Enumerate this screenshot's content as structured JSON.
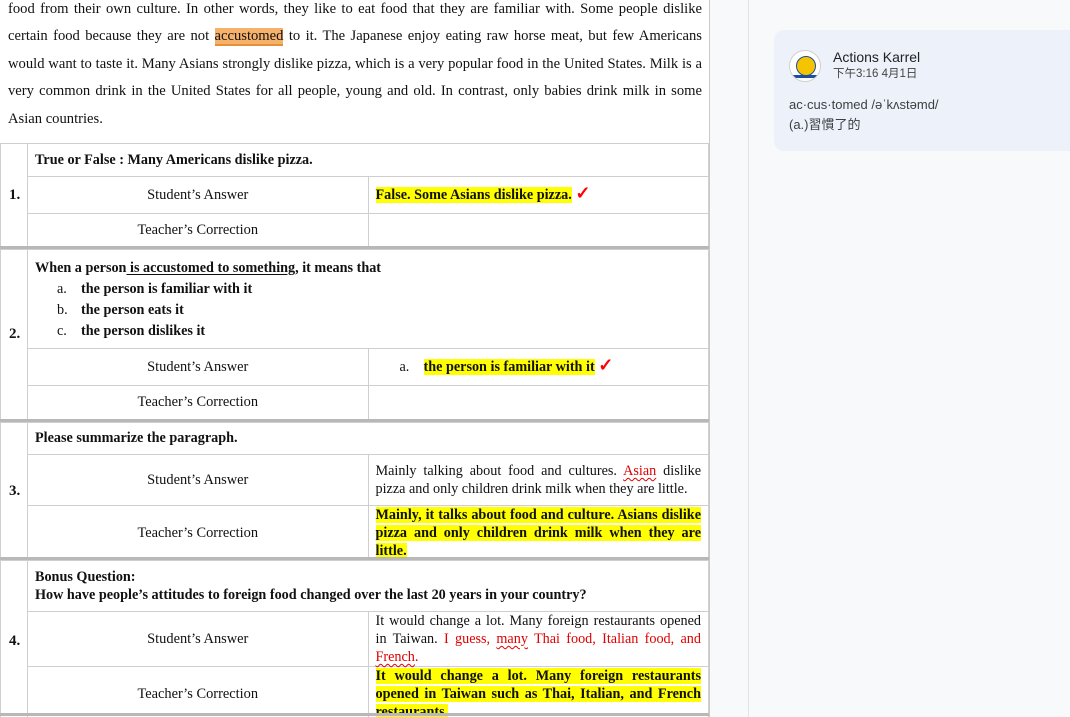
{
  "paragraph": {
    "before": "food from their own culture. In other words, they like to eat food that they are familiar with. Some people dislike certain food because they are not ",
    "highlight": "accustomed",
    "after": " to it. The Japanese enjoy eating raw horse meat, but few Americans would want to taste it. Many Asians strongly dislike pizza, which is a very popular food in the United States. Milk is a very common drink in the United States for all people, young and old. In contrast, only babies drink milk in some Asian countries."
  },
  "labels": {
    "student_answer": "Student’s Answer",
    "teacher_correction": "Teacher’s Correction"
  },
  "check_mark": "✓",
  "q1": {
    "number": "1.",
    "question": "True or False : Many Americans dislike pizza.",
    "answer": "False. Some Asians dislike pizza.",
    "correction": ""
  },
  "q2": {
    "number": "2.",
    "stem_before": "When a person",
    "stem_underline": " is accustomed to something",
    "stem_after": ", it means that",
    "options": [
      {
        "letter": "a.",
        "text": "the person is familiar with it"
      },
      {
        "letter": "b.",
        "text": "the person eats it"
      },
      {
        "letter": "c.",
        "text": "the person dislikes it"
      }
    ],
    "answer_letter": "a.",
    "answer_text": "the person is familiar with it",
    "correction": ""
  },
  "q3": {
    "number": "3.",
    "question": "Please summarize the paragraph.",
    "answer_part1": "Mainly talking about food and cultures. ",
    "answer_red": "Asian",
    "answer_part2": " dislike pizza and only children drink milk when they are little.",
    "correction": "Mainly, it talks about food and culture. Asians dislike pizza and only children drink milk when they are little."
  },
  "q4": {
    "number": "4.",
    "question_line1": "Bonus Question:",
    "question_line2": "How have people’s attitudes to foreign food changed over the last 20 years in your country?",
    "answer_black": "It would change a lot. Many foreign restaurants opened in Taiwan. ",
    "answer_red1": "I guess, ",
    "answer_red_many": "many",
    "answer_red2": " Thai food, Italian food, and ",
    "answer_red_french": "French",
    "answer_red3": ".",
    "correction": "It would change a lot. Many foreign restaurants opened in Taiwan such as Thai, Italian, and French restaurants."
  },
  "comment": {
    "author": "Actions Karrel",
    "time": "下午3:16 4月1日",
    "word": "ac·cus·tomed /əˈkʌstəmd/",
    "meaning": "(a.)習慣了的"
  },
  "colors": {
    "highlight_yellow": "#ffff00",
    "highlight_orange": "#f6b26b",
    "check_red": "#ff0000",
    "error_red": "#e00000",
    "comment_bg": "#edf2fa"
  }
}
